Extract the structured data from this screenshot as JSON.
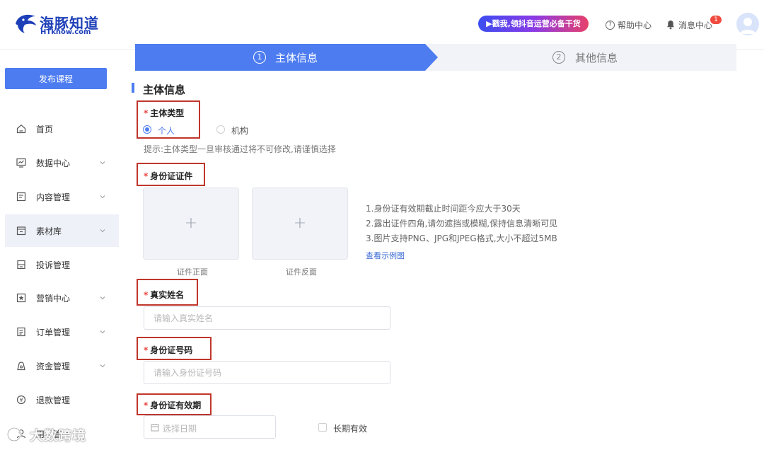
{
  "header": {
    "logo_cn": "海豚知道",
    "logo_en": "HTknow.com",
    "promo": "▶戳我,领抖音运营必备干货",
    "help": "帮助中心",
    "messages": "消息中心",
    "badge": "1"
  },
  "sidebar": {
    "publish_button": "发布课程",
    "items": [
      {
        "label": "首页",
        "icon": "home-icon"
      },
      {
        "label": "数据中心",
        "icon": "chart-icon"
      },
      {
        "label": "内容管理",
        "icon": "content-icon"
      },
      {
        "label": "素材库",
        "icon": "folder-icon"
      },
      {
        "label": "投诉管理",
        "icon": "complaint-icon"
      },
      {
        "label": "营销中心",
        "icon": "star-icon"
      },
      {
        "label": "订单管理",
        "icon": "order-icon"
      },
      {
        "label": "资金管理",
        "icon": "wallet-icon"
      },
      {
        "label": "退款管理",
        "icon": "refund-icon"
      },
      {
        "label": "用户管理",
        "icon": "user-icon"
      }
    ]
  },
  "steps": [
    {
      "num": "1",
      "label": "主体信息"
    },
    {
      "num": "2",
      "label": "其他信息"
    }
  ],
  "form": {
    "section_title": "主体信息",
    "subject_type_label": "主体类型",
    "options": [
      "个人",
      "机构"
    ],
    "hint": "提示:主体类型一旦审核通过将不可修改,请谨慎选择",
    "id_doc_label": "身份证证件",
    "upload_front": "证件正面",
    "upload_back": "证件反面",
    "requirements": [
      "1.身份证有效期截止时间距今应大于30天",
      "2.露出证件四角,请勿遮挡或模糊,保持信息清晰可见",
      "3.图片支持PNG、JPG和JPEG格式,大小不超过5MB"
    ],
    "example_link": "查看示例图",
    "name_label": "真实姓名",
    "name_placeholder": "请输入真实姓名",
    "id_number_label": "身份证号码",
    "id_number_placeholder": "请输入身份证号码",
    "validity_label": "身份证有效期",
    "date_placeholder": "选择日期",
    "long_term": "长期有效"
  },
  "watermark": "大数跨境",
  "colors": {
    "accent": "#4d7cf0",
    "highlight": "#c0362c",
    "required": "#e8413b"
  }
}
